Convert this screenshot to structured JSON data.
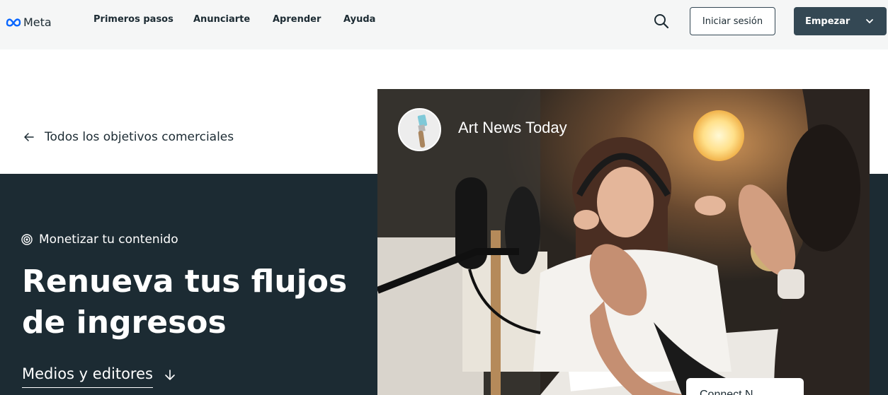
{
  "header": {
    "logo_text": "Meta",
    "nav": [
      "Primeros pasos",
      "Anunciarte",
      "Aprender",
      "Ayuda"
    ],
    "login_label": "Iniciar sesión",
    "start_label": "Empezar"
  },
  "back_link": {
    "label": "Todos los objetivos comerciales"
  },
  "hero": {
    "objective": "Monetizar tu contenido",
    "headline": "Renueva tus flujos de ingresos",
    "sector": "Medios y editores"
  },
  "photo": {
    "page_name": "Art News Today",
    "card_text": "Connect N..."
  },
  "colors": {
    "dark_bg": "#1c2b33",
    "header_bg": "#f5f6f6",
    "button_dark": "#344854"
  }
}
